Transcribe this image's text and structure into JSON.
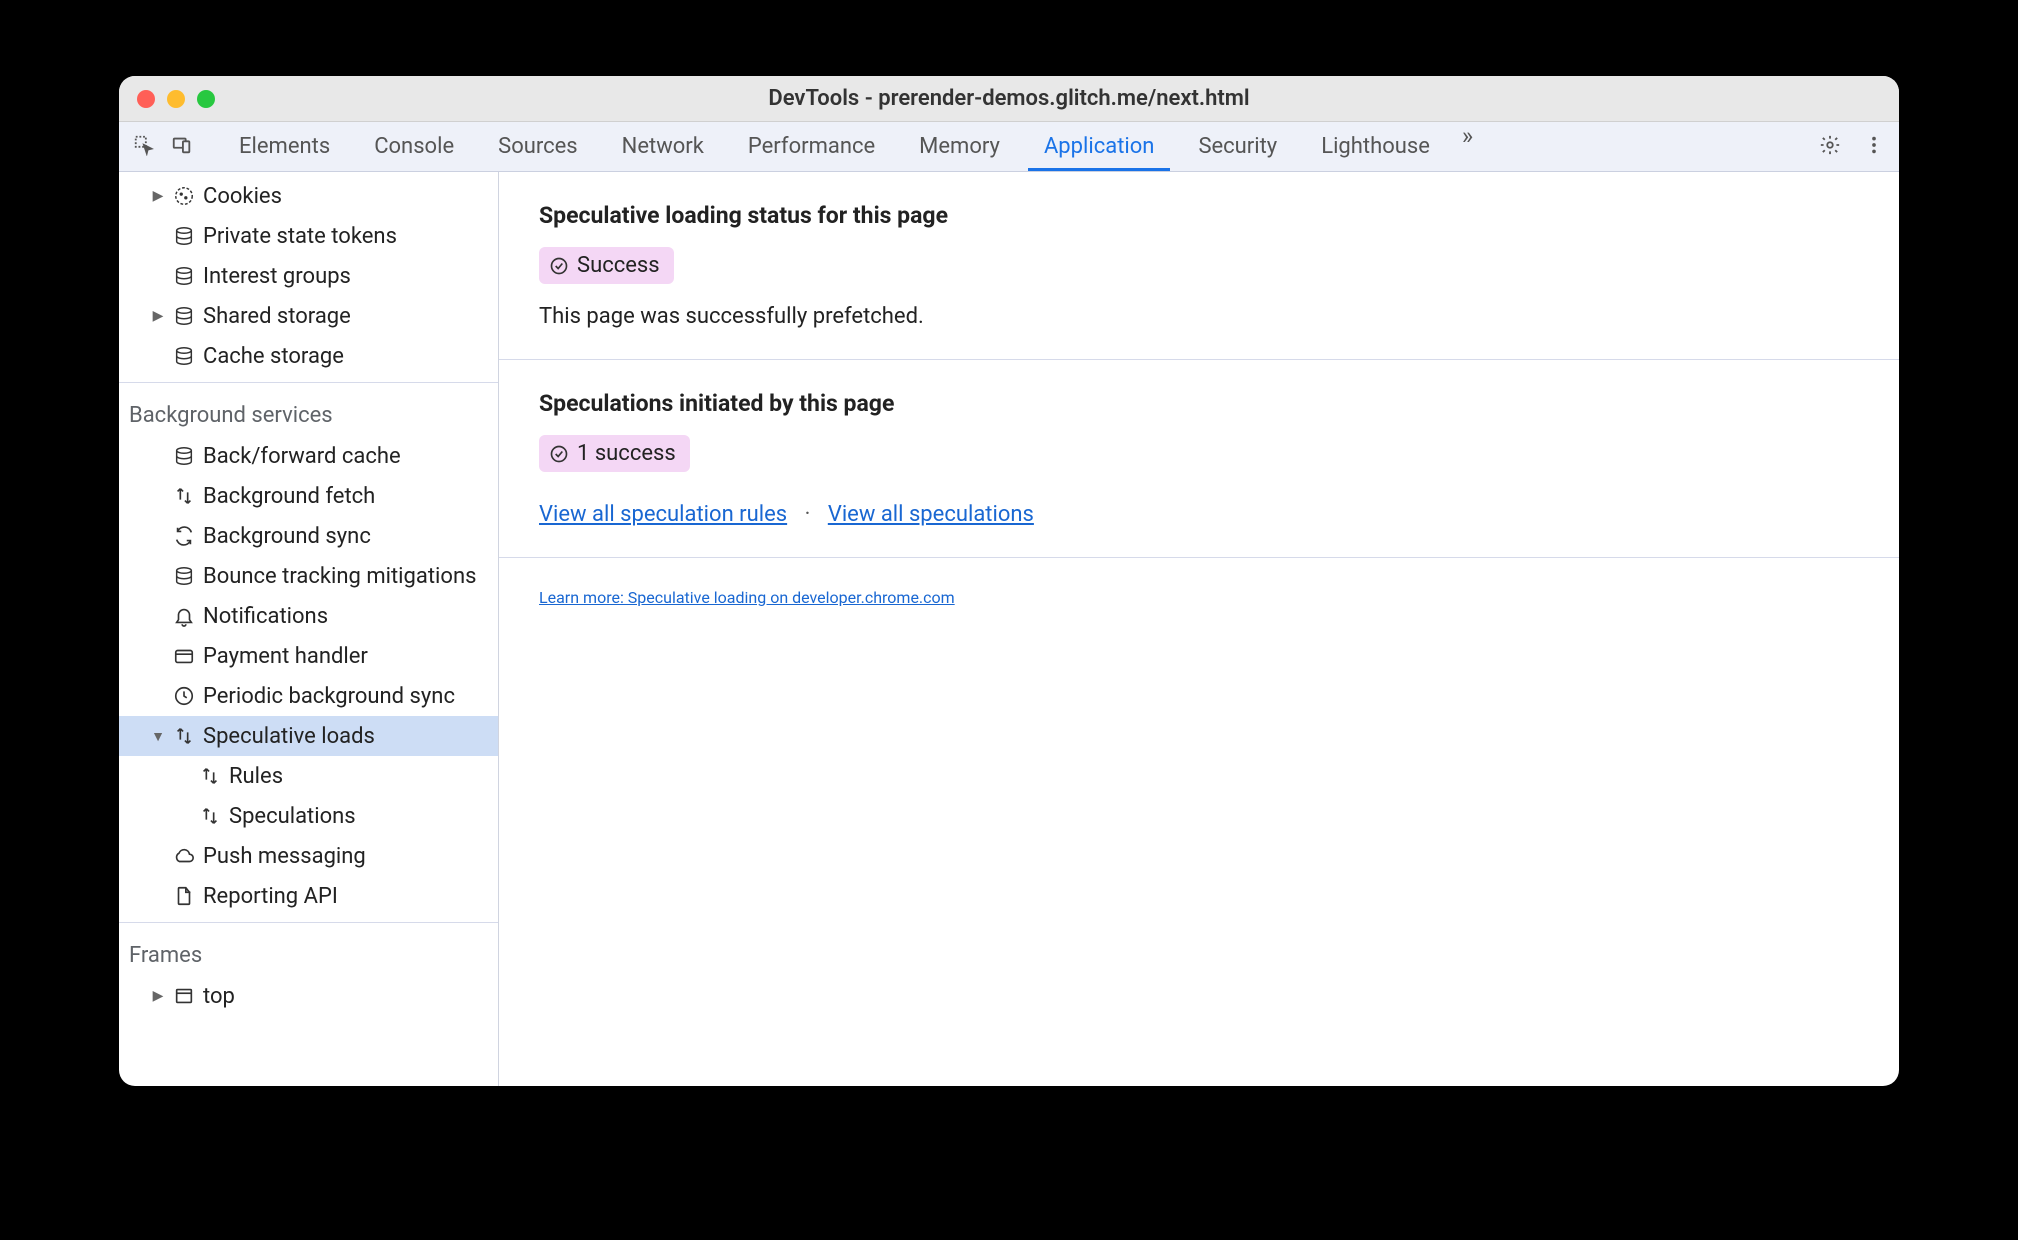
{
  "window": {
    "title": "DevTools - prerender-demos.glitch.me/next.html"
  },
  "tabs": {
    "elements": "Elements",
    "console": "Console",
    "sources": "Sources",
    "network": "Network",
    "performance": "Performance",
    "memory": "Memory",
    "application": "Application",
    "security": "Security",
    "lighthouse": "Lighthouse"
  },
  "sidebar": {
    "storage": {
      "cookies": "Cookies",
      "private_state_tokens": "Private state tokens",
      "interest_groups": "Interest groups",
      "shared_storage": "Shared storage",
      "cache_storage": "Cache storage"
    },
    "bg_header": "Background services",
    "bg": {
      "back_forward": "Back/forward cache",
      "background_fetch": "Background fetch",
      "background_sync": "Background sync",
      "bounce_tracking": "Bounce tracking mitigations",
      "notifications": "Notifications",
      "payment_handler": "Payment handler",
      "periodic_bg_sync": "Periodic background sync",
      "speculative_loads": "Speculative loads",
      "rules": "Rules",
      "speculations": "Speculations",
      "push_messaging": "Push messaging",
      "reporting_api": "Reporting API"
    },
    "frames_header": "Frames",
    "frames": {
      "top": "top"
    }
  },
  "main": {
    "status_heading": "Speculative loading status for this page",
    "status_badge": "Success",
    "status_text": "This page was successfully prefetched.",
    "initiated_heading": "Speculations initiated by this page",
    "initiated_badge": "1 success",
    "link_rules": "View all speculation rules",
    "link_speculations": "View all speculations",
    "learn_more": "Learn more: Speculative loading on developer.chrome.com"
  }
}
